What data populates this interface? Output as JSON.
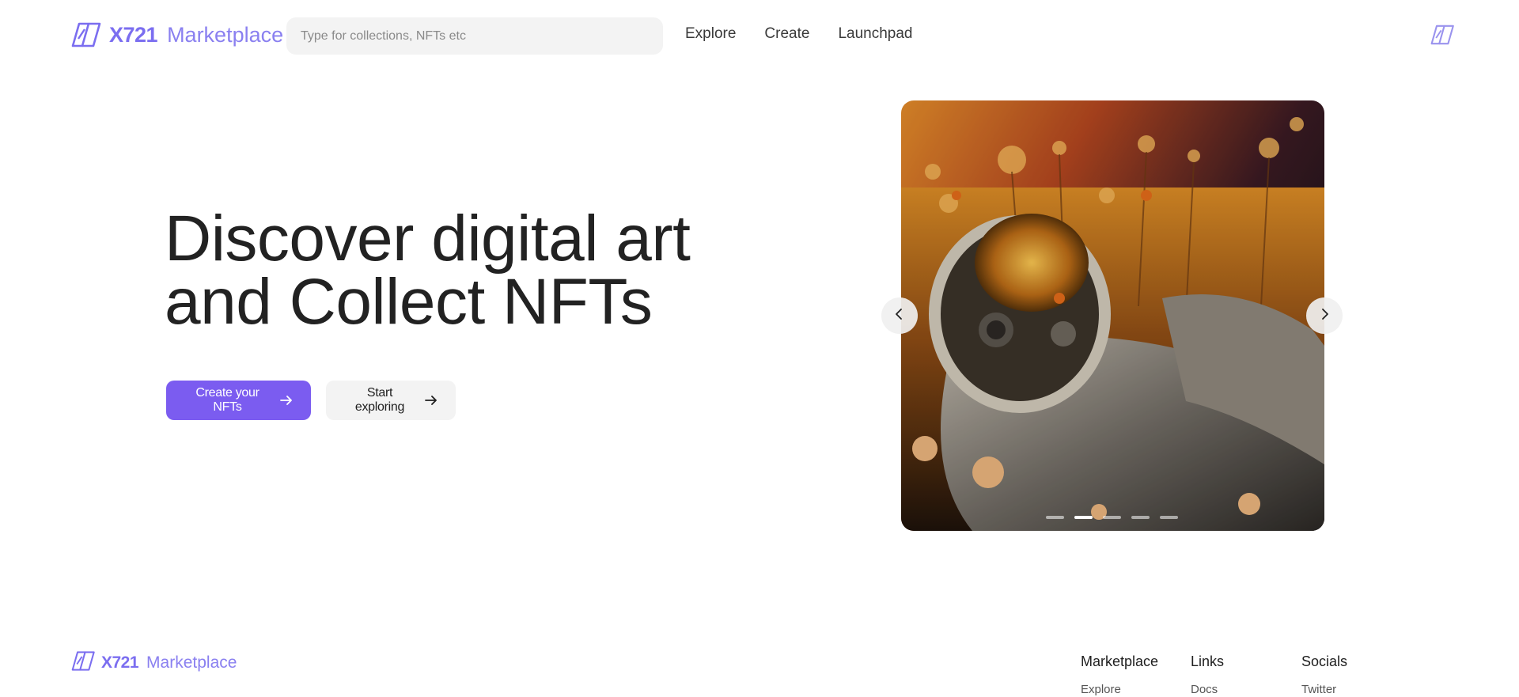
{
  "brand": {
    "name_bold": "X721",
    "name_light": "Marketplace",
    "accent": "#7b6ef0"
  },
  "search": {
    "placeholder": "Type for collections, NFTs etc"
  },
  "nav": {
    "items": [
      {
        "label": "Explore"
      },
      {
        "label": "Create"
      },
      {
        "label": "Launchpad"
      }
    ]
  },
  "hero": {
    "title_line1": "Discover digital art",
    "title_line2": "and Collect NFTs",
    "primary_button": "Create your NFTs",
    "secondary_button": "Start exploring",
    "primary_color": "#7b5cf0"
  },
  "carousel": {
    "slide_count": 5,
    "active_slide_index": 1
  },
  "footer": {
    "columns": [
      {
        "title": "Marketplace",
        "links": [
          "Explore"
        ]
      },
      {
        "title": "Links",
        "links": [
          "Docs"
        ]
      },
      {
        "title": "Socials",
        "links": [
          "Twitter"
        ]
      }
    ]
  }
}
